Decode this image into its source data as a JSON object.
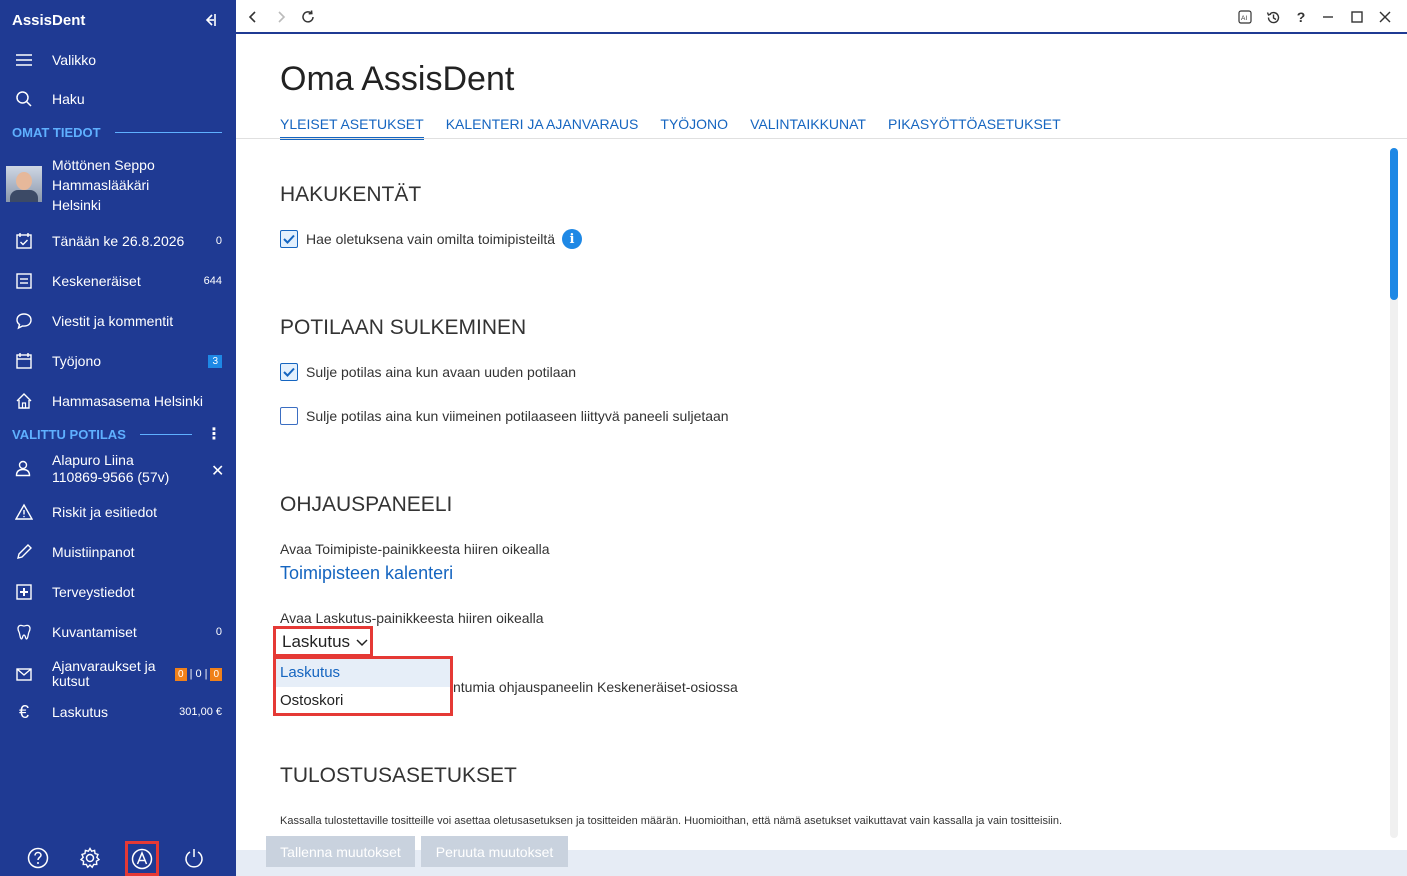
{
  "app": {
    "title": "AssisDent"
  },
  "sidebar": {
    "menu": "Valikko",
    "search": "Haku",
    "own_section": "OMAT TIEDOT",
    "user": {
      "name": "Möttönen Seppo",
      "role": "Hammaslääkäri",
      "city": "Helsinki"
    },
    "items": [
      {
        "label": "Tänään ke 26.8.2026",
        "count": "0"
      },
      {
        "label": "Keskeneräiset",
        "count": "644"
      },
      {
        "label": "Viestit ja kommentit",
        "count": ""
      },
      {
        "label": "Työjono",
        "count": "3"
      },
      {
        "label": "Hammasasema Helsinki",
        "count": ""
      }
    ],
    "patient_section": "VALITTU POTILAS",
    "patient": {
      "name": "Alapuro Liina",
      "id": "110869-9566 (57v)"
    },
    "patient_items": [
      {
        "label": "Riskit ja esitiedot",
        "count": ""
      },
      {
        "label": "Muistiinpanot",
        "count": ""
      },
      {
        "label": "Terveystiedot",
        "count": ""
      },
      {
        "label": "Kuvantamiset",
        "count": "0"
      },
      {
        "label_line1": "Ajanvaraukset ja",
        "label_line2": "kutsut",
        "counts": [
          "0",
          "0",
          "0"
        ]
      },
      {
        "label": "Laskutus",
        "count": "301,00 €"
      }
    ]
  },
  "main": {
    "title": "Oma AssisDent",
    "tabs": [
      "YLEISET ASETUKSET",
      "KALENTERI JA AJANVARAUS",
      "TYÖJONO",
      "VALINTAIKKUNAT",
      "PIKASYÖTTÖASETUKSET"
    ],
    "sections": {
      "search": {
        "heading": "HAKUKENTÄT",
        "checkbox": "Hae oletuksena vain omilta toimipisteiltä"
      },
      "close": {
        "heading": "POTILAAN SULKEMINEN",
        "cb1": "Sulje potilas aina kun avaan uuden potilaan",
        "cb2": "Sulje potilas aina kun viimeinen potilaaseen liittyvä paneeli suljetaan"
      },
      "panel": {
        "heading": "OHJAUSPANEELI",
        "text1": "Avaa Toimipiste-painikkeesta hiiren oikealla",
        "link1": "Toimipisteen kalenteri",
        "text2": "Avaa Laskutus-painikkeesta hiiren oikealla",
        "dropdown_value": "Laskutus",
        "options": [
          "Laskutus",
          "Ostoskori"
        ],
        "hidden_text": "ntumia ohjauspaneelin Keskeneräiset-osiossa"
      },
      "print": {
        "heading": "TULOSTUSASETUKSET",
        "desc": "Kassalla tulostettaville tositteille voi asettaa oletusasetuksen ja tositteiden määrän. Huomioithan, että nämä asetukset vaikuttavat vain kassalla ja vain tositteisiin."
      }
    },
    "footer": {
      "save": "Tallenna muutokset",
      "cancel": "Peruuta muutokset"
    }
  }
}
